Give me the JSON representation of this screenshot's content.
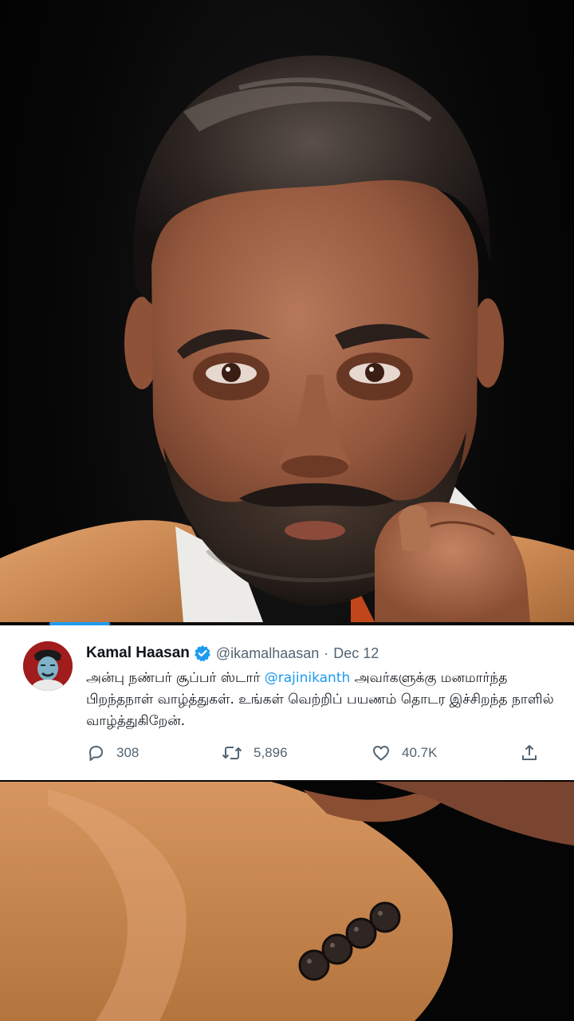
{
  "tweet": {
    "display_name": "Kamal Haasan",
    "verified_icon": "verified-badge-icon",
    "handle": "@ikamalhaasan",
    "separator": "·",
    "date": "Dec 12",
    "text_before_mention": "அன்பு நண்பர் சூப்பர் ஸ்டார் ",
    "mention": "@rajinikanth",
    "text_after_mention": " அவர்களுக்கு மனமார்ந்த பிறந்தநாள் வாழ்த்துகள். உங்கள் வெற்றிப் பயணம் தொடர இச்சிறந்த நாளில் வாழ்த்துகிறேன்.",
    "actions": {
      "reply": {
        "icon": "reply-icon",
        "count": "308"
      },
      "retweet": {
        "icon": "retweet-icon",
        "count": "5,896"
      },
      "like": {
        "icon": "heart-icon",
        "count": "40.7K"
      },
      "share": {
        "icon": "share-icon"
      }
    }
  },
  "colors": {
    "accent": "#1d9bf0",
    "text_primary": "#0f1419",
    "text_secondary": "#536471",
    "background": "#000000",
    "card": "#ffffff"
  }
}
